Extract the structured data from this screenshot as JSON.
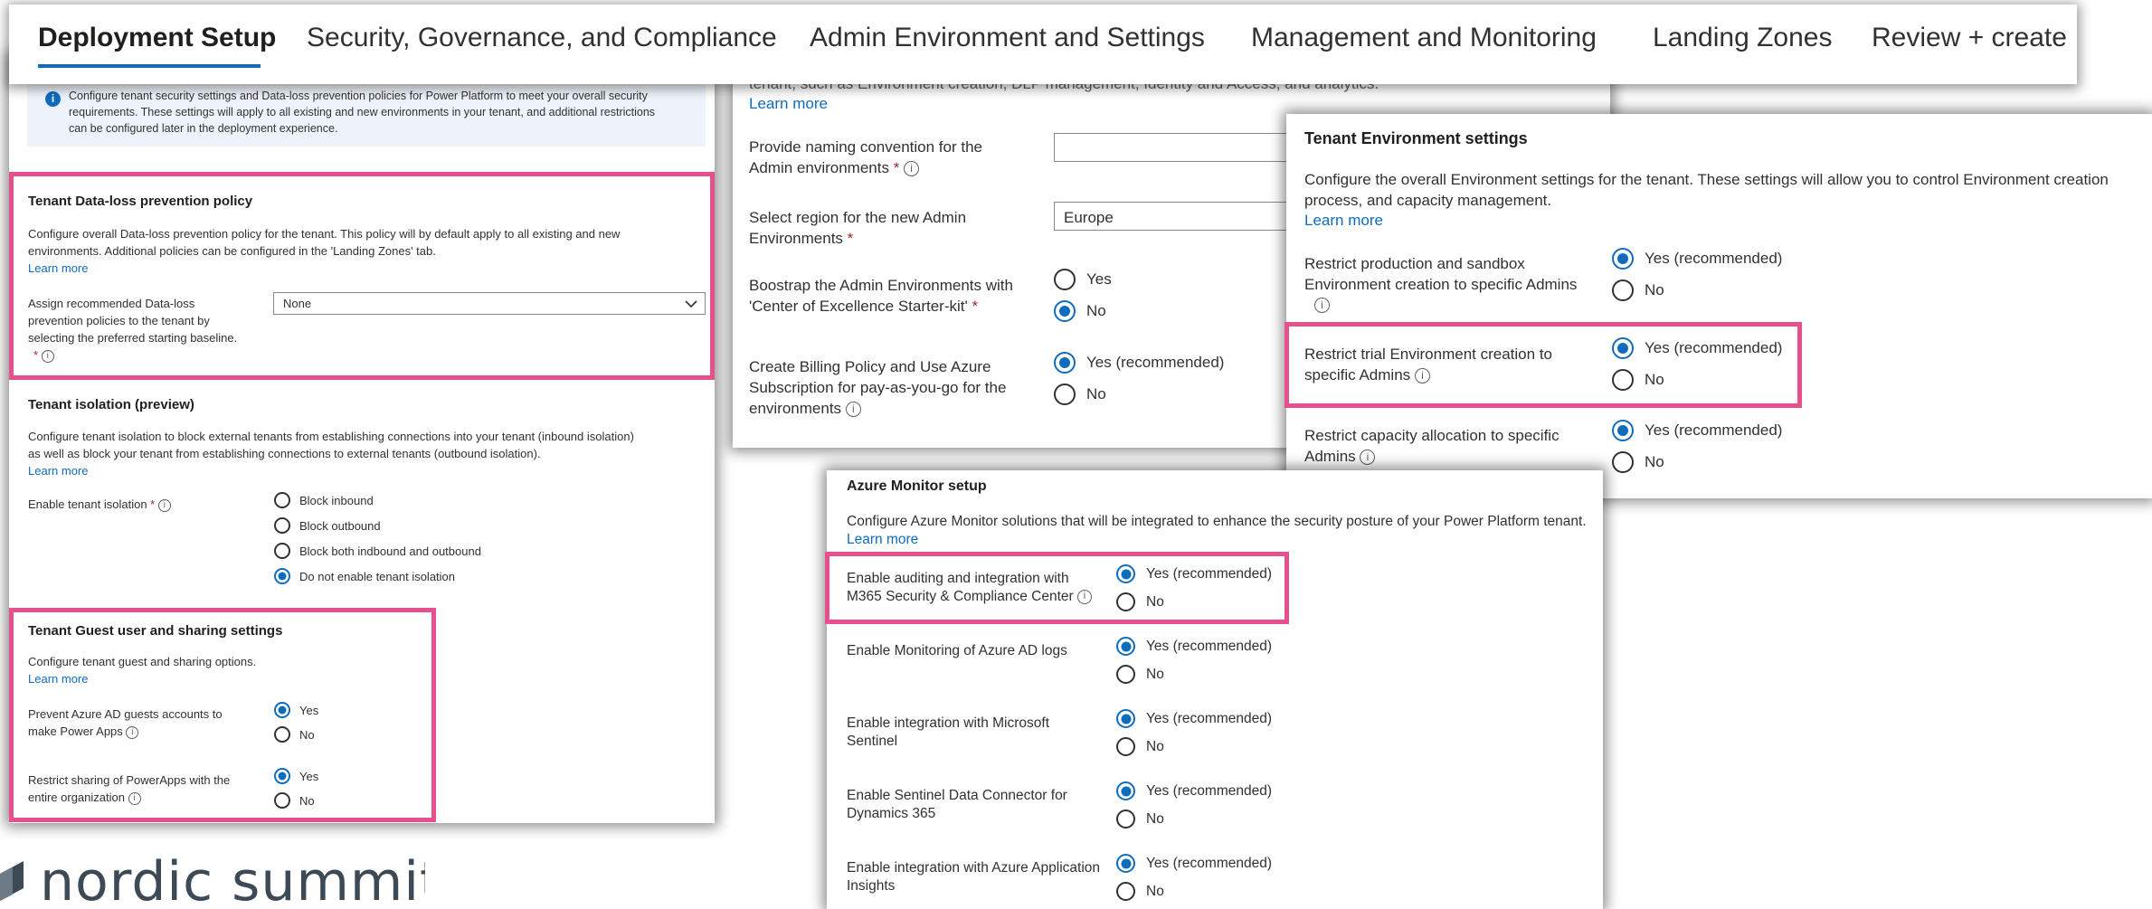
{
  "tabs": {
    "items": [
      {
        "label": "Deployment Setup"
      },
      {
        "label": "Security, Governance, and Compliance"
      },
      {
        "label": "Admin Environment and Settings"
      },
      {
        "label": "Management and Monitoring"
      },
      {
        "label": "Landing Zones"
      },
      {
        "label": "Review + create"
      }
    ],
    "active_index": 0
  },
  "security_panel": {
    "banner_text": [
      "Configure tenant security settings and Data-loss prevention policies for Power Platform to meet your overall security",
      "requirements. These settings will apply to all existing and new environments in your tenant, and additional restrictions",
      "can be configured later in the deployment experience."
    ],
    "dlp": {
      "title": "Tenant Data-loss prevention policy",
      "description": [
        "Configure overall Data-loss prevention policy for the tenant. This policy will by default apply to all existing and new",
        "environments. Additional policies can be configured in the 'Landing Zones' tab."
      ],
      "learn_more": "Learn more",
      "assign_label": [
        "Assign recommended Data-loss",
        "prevention policies to the tenant by",
        "selecting the preferred starting baseline."
      ],
      "select_value": "None"
    },
    "isolation": {
      "title": "Tenant isolation (preview)",
      "description": [
        "Configure tenant isolation to block external tenants from establishing connections into your tenant (inbound isolation)",
        "as well as block your tenant from establishing connections to external tenants (outbound isolation)."
      ],
      "learn_more": "Learn more",
      "enable_label": "Enable tenant isolation",
      "options": [
        "Block inbound",
        "Block outbound",
        "Block both indbound and outbound",
        "Do not enable tenant isolation"
      ],
      "selected": "Do not enable tenant isolation"
    },
    "guest": {
      "title": "Tenant Guest user and sharing settings",
      "description": "Configure tenant guest and sharing options.",
      "learn_more": "Learn more",
      "prevent_label": [
        "Prevent Azure AD guests accounts to",
        "make Power Apps"
      ],
      "restrict_label": [
        "Restrict sharing of PowerApps with the",
        "entire organization"
      ],
      "yes": "Yes",
      "no": "No",
      "prevent_selected": "Yes",
      "restrict_selected": "Yes"
    }
  },
  "admin_panel": {
    "top_cut_text": "tenant, such as Environment creation, DLP management, Identity and Access, and analytics.",
    "learn_more": "Learn more",
    "naming_label": [
      "Provide naming convention for the",
      "Admin environments"
    ],
    "naming_value": "",
    "region_label": [
      "Select region for the new Admin",
      "Environments"
    ],
    "region_value": "Europe",
    "bootstrap_label": [
      "Boostrap the Admin Environments with",
      "'Center of Excellence Starter-kit'"
    ],
    "bootstrap_options": [
      "Yes",
      "No"
    ],
    "bootstrap_selected": "No",
    "billing_label": [
      "Create Billing Policy and Use Azure",
      "Subscription for pay-as-you-go for the",
      "environments"
    ],
    "billing_options": [
      "Yes (recommended)",
      "No"
    ],
    "billing_selected": "Yes (recommended)"
  },
  "env_panel": {
    "title": "Tenant Environment settings",
    "description": [
      "Configure the overall Environment settings for the tenant. These settings will allow you to control Environment creation",
      "process, and capacity management."
    ],
    "learn_more": "Learn more",
    "prod_label": [
      "Restrict production and sandbox",
      "Environment creation to specific Admins"
    ],
    "trial_label": [
      "Restrict trial Environment creation to",
      "specific Admins"
    ],
    "capacity_label": [
      "Restrict capacity allocation to specific",
      "Admins"
    ],
    "yes": "Yes (recommended)",
    "no": "No"
  },
  "monitor_panel": {
    "title": "Azure Monitor setup",
    "description": "Configure Azure Monitor solutions that will be integrated to enhance the security posture of your Power Platform tenant.",
    "learn_more": "Learn more",
    "rows": [
      {
        "label": [
          "Enable auditing and integration with",
          "M365 Security & Compliance Center"
        ],
        "info": true
      },
      {
        "label": [
          "Enable Monitoring of Azure AD logs",
          ""
        ],
        "info": false
      },
      {
        "label": [
          "Enable integration with Microsoft",
          "Sentinel"
        ],
        "info": false
      },
      {
        "label": [
          "Enable Sentinel Data Connector for",
          "Dynamics 365"
        ],
        "info": false
      },
      {
        "label": [
          "Enable integration with Azure Application",
          "Insights"
        ],
        "info": false
      }
    ],
    "yes": "Yes (recommended)",
    "no": "No"
  },
  "brand": {
    "logo_text": "nordic summit",
    "highlight_color": "#e6508f",
    "accent_color": "#0f6cbd",
    "logo_color": "#3d4a55"
  }
}
